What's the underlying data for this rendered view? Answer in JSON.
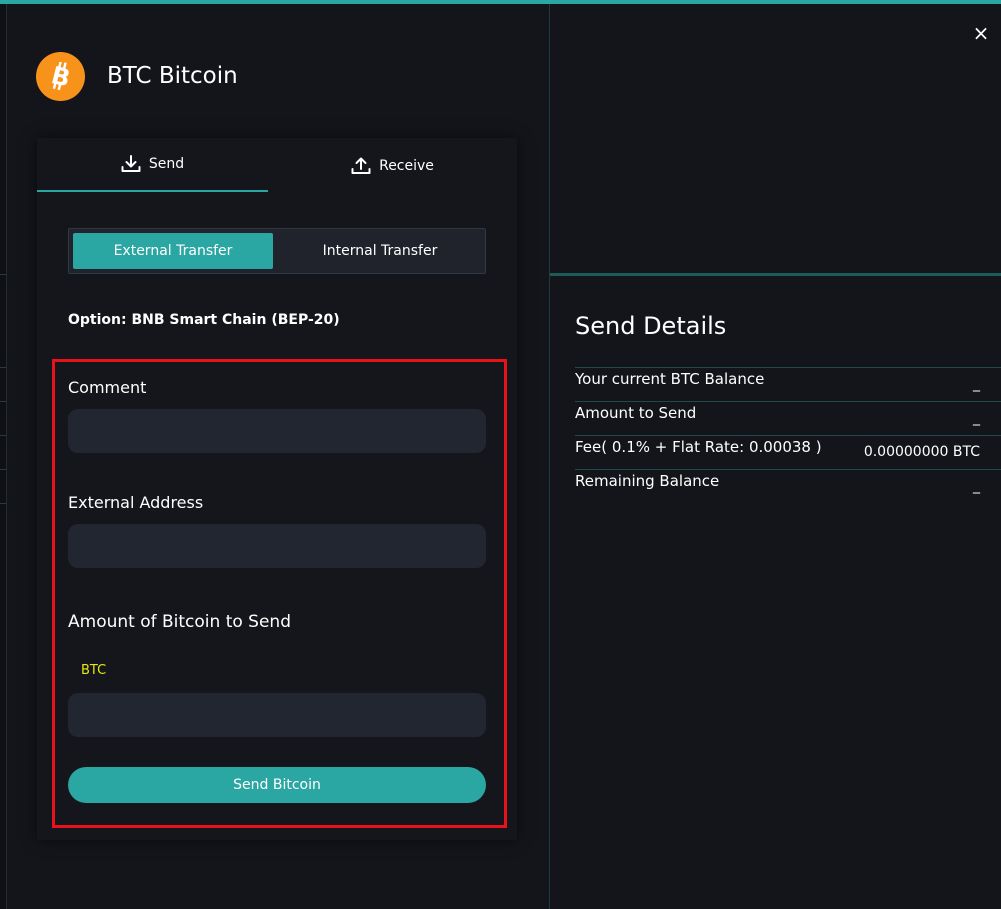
{
  "app": {
    "title": "BTC Bitcoin",
    "close_label": "×",
    "logo_icon": "bitcoin-icon",
    "accent_color": "#2aa7a3",
    "brand_color": "#f7931a"
  },
  "tabs": {
    "send_label": "Send",
    "receive_label": "Receive",
    "active": "Send"
  },
  "transfer_toggle": {
    "external_label": "External Transfer",
    "internal_label": "Internal Transfer",
    "selected": "External Transfer"
  },
  "option_text": "Option: BNB Smart Chain (BEP-20)",
  "form": {
    "comment_label": "Comment",
    "comment_value": "",
    "address_label": "External Address",
    "address_value": "",
    "amount_label": "Amount of Bitcoin to Send",
    "currency": "BTC",
    "amount_value": "",
    "send_label": "Send Bitcoin"
  },
  "details": {
    "title": "Send Details",
    "rows": [
      {
        "label": "Your current BTC Balance",
        "value": "_"
      },
      {
        "label": "Amount to Send",
        "value": "_"
      },
      {
        "label": "Fee( 0.1% + Flat Rate: 0.00038 )",
        "value": "0.00000000 BTC"
      },
      {
        "label": "Remaining Balance",
        "value": "_"
      }
    ]
  }
}
